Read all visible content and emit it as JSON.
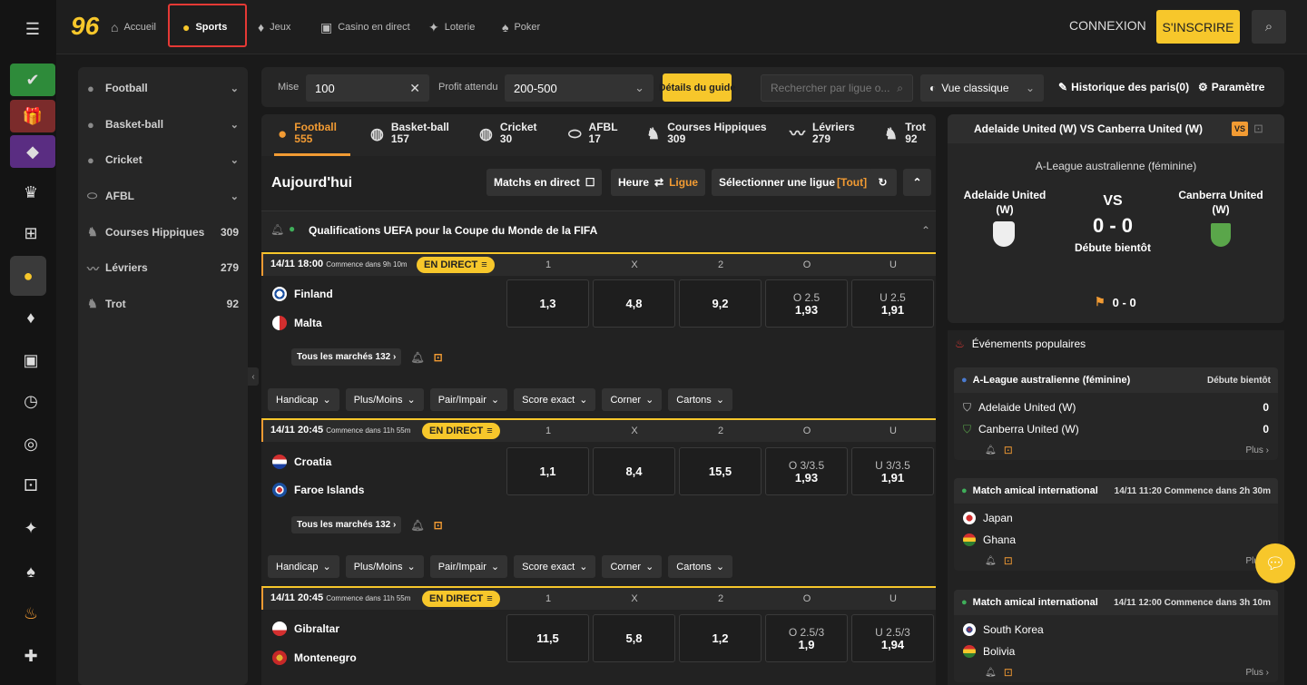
{
  "rail": {
    "menu_icon": "menu-icon"
  },
  "nav": {
    "logo": "96",
    "items": [
      {
        "label": "Accueil"
      },
      {
        "label": "Sports"
      },
      {
        "label": "Jeux"
      },
      {
        "label": "Casino en direct"
      },
      {
        "label": "Loterie"
      },
      {
        "label": "Poker"
      }
    ],
    "connexion": "CONNEXION",
    "inscrire": "S'INSCRIRE"
  },
  "sidebar": {
    "items": [
      {
        "label": "Football",
        "count": ""
      },
      {
        "label": "Basket-ball",
        "count": ""
      },
      {
        "label": "Cricket",
        "count": ""
      },
      {
        "label": "AFBL",
        "count": ""
      },
      {
        "label": "Courses Hippiques",
        "count": "309"
      },
      {
        "label": "Lévriers",
        "count": "279"
      },
      {
        "label": "Trot",
        "count": "92"
      }
    ]
  },
  "bar": {
    "mise_label": "Mise",
    "mise_value": "100",
    "profit_label": "Profit attendu",
    "profit_value": "200-500",
    "guide": "Détails du guide",
    "search_placeholder": "Rechercher par ligue o...",
    "vue": "Vue classique",
    "history": "Historique des paris(0)",
    "settings": "Paramètre"
  },
  "tabs": [
    {
      "label": "Football",
      "count": "555"
    },
    {
      "label": "Basket-ball",
      "count": "157"
    },
    {
      "label": "Cricket",
      "count": "30"
    },
    {
      "label": "AFBL",
      "count": "17"
    },
    {
      "label": "Courses Hippiques",
      "count": "309"
    },
    {
      "label": "Lévriers",
      "count": "279"
    },
    {
      "label": "Trot",
      "count": "92"
    }
  ],
  "today": {
    "title": "Aujourd'hui",
    "live_matches": "Matchs en direct",
    "heure": "Heure",
    "ligue": "Ligue",
    "select_league": "Sélectionner une ligue",
    "tout": "[Tout]"
  },
  "league_title": "Qualifications UEFA pour la Coupe du Monde de la FIFA",
  "columns": [
    "1",
    "X",
    "2",
    "O",
    "U"
  ],
  "live_badge": "EN DIRECT",
  "markets_prefix": "Tous les marchés",
  "filters": [
    "Handicap",
    "Plus/Moins",
    "Pair/Impair",
    "Score exact",
    "Corner",
    "Cartons"
  ],
  "matches": [
    {
      "time": "14/11 18:00",
      "countdown": "Commence dans 9h 10m",
      "home": "Finland",
      "away": "Malta",
      "o1": "1,3",
      "ox": "4,8",
      "o2": "9,2",
      "o_line": "O 2.5",
      "o_val": "1,93",
      "u_line": "U 2.5",
      "u_val": "1,91",
      "markets": "132"
    },
    {
      "time": "14/11 20:45",
      "countdown": "Commence dans 11h 55m",
      "home": "Croatia",
      "away": "Faroe Islands",
      "o1": "1,1",
      "ox": "8,4",
      "o2": "15,5",
      "o_line": "O 3/3.5",
      "o_val": "1,93",
      "u_line": "U 3/3.5",
      "u_val": "1,91",
      "markets": "132"
    },
    {
      "time": "14/11 20:45",
      "countdown": "Commence dans 11h 55m",
      "home": "Gibraltar",
      "away": "Montenegro",
      "o1": "11,5",
      "ox": "5,8",
      "o2": "1,2",
      "o_line": "O 2.5/3",
      "o_val": "1,9",
      "u_line": "U 2.5/3",
      "u_val": "1,94",
      "markets": ""
    }
  ],
  "featured": {
    "title": "Adelaide United (W) VS Canberra United (W)",
    "vs_badge": "VS",
    "league": "A-League australienne (féminine)",
    "home": "Adelaide United (W)",
    "away": "Canberra United (W)",
    "vs": "VS",
    "score": "0 - 0",
    "status": "Débute bientôt",
    "corner_score": "0 - 0"
  },
  "popular": {
    "title": "Événements populaires",
    "plus": "Plus",
    "events": [
      {
        "league": "A-League australienne (féminine)",
        "when": "Débute bientôt",
        "home": "Adelaide United (W)",
        "away": "Canberra United (W)",
        "hs": "0",
        "as": "0"
      },
      {
        "league": "Match amical international",
        "when": "14/11 11:20 Commence dans 2h 30m",
        "home": "Japan",
        "away": "Ghana",
        "hs": "",
        "as": ""
      },
      {
        "league": "Match amical international",
        "when": "14/11 12:00 Commence dans 3h 10m",
        "home": "South Korea",
        "away": "Bolivia",
        "hs": "",
        "as": ""
      }
    ]
  }
}
